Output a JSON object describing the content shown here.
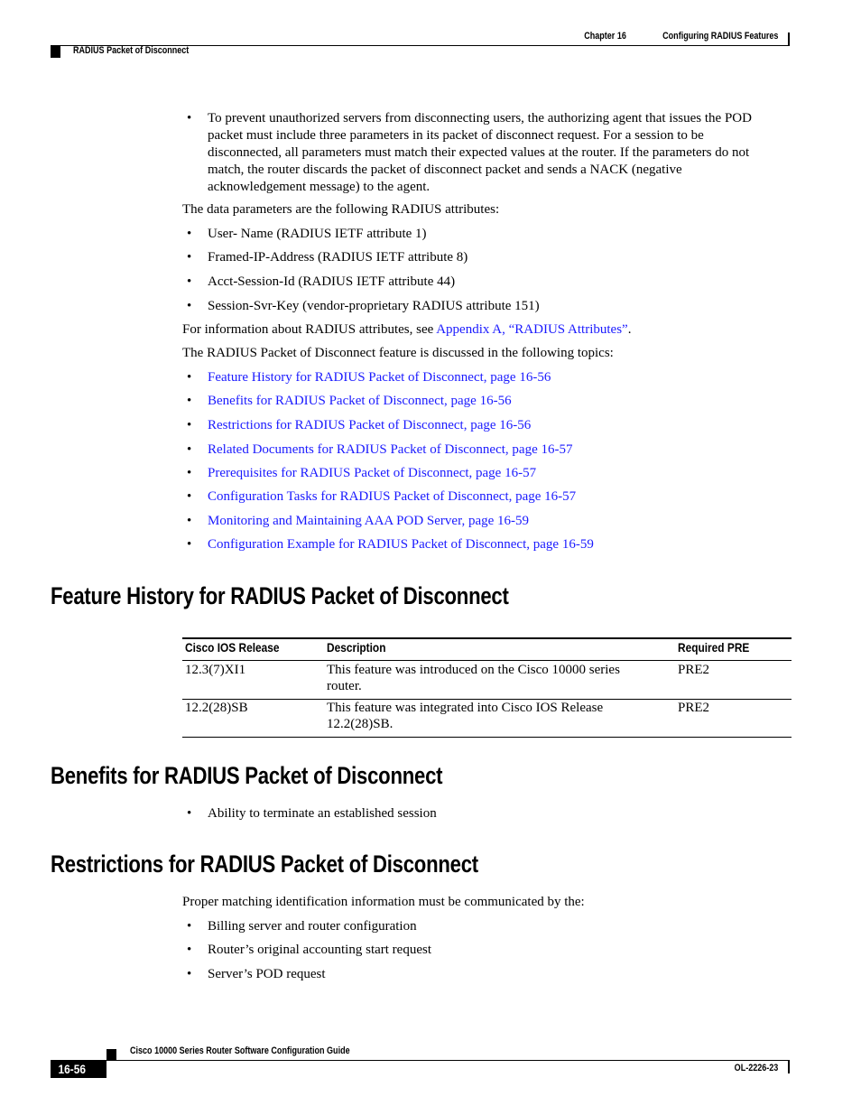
{
  "header": {
    "chapter": "Chapter 16",
    "chapter_title": "Configuring RADIUS Features",
    "section": "RADIUS Packet of Disconnect"
  },
  "intro": {
    "bullet_pod": "To prevent unauthorized servers from disconnecting users, the authorizing agent that issues the POD packet must include three parameters in its packet of disconnect request. For a session to be disconnected, all parameters must match their expected values at the router. If the parameters do not match, the router discards the packet of disconnect packet and sends a NACK (negative acknowledgement message) to the agent.",
    "bullet_pod_lines": [
      "To prevent unauthorized servers from disconnecting users, the authorizing agent that issues the POD",
      "packet must include three parameters in its packet of disconnect request. For a session to be",
      "disconnected, all parameters must match their expected values at the router. If the parameters do not",
      "match, the router discards the packet of disconnect packet and sends a NACK (negative",
      "acknowledgement message) to the agent."
    ],
    "data_params_text": "The data parameters are the following RADIUS attributes:",
    "attributes": [
      "User- Name (RADIUS IETF attribute 1)",
      "Framed-IP-Address (RADIUS IETF attribute 8)",
      "Acct-Session-Id (RADIUS IETF attribute 44)",
      "Session-Svr-Key (vendor-proprietary RADIUS attribute 151)"
    ],
    "info_prefix": "For information about RADIUS attributes, see ",
    "info_link": "Appendix A, “RADIUS Attributes”",
    "info_suffix": ".",
    "topics_intro": "The RADIUS Packet of Disconnect feature is discussed in the following topics:",
    "topics": [
      "Feature History for RADIUS Packet of Disconnect, page 16-56",
      "Benefits for RADIUS Packet of Disconnect, page 16-56",
      "Restrictions for RADIUS Packet of Disconnect, page 16-56",
      "Related Documents for RADIUS Packet of Disconnect, page 16-57",
      "Prerequisites for RADIUS Packet of Disconnect, page 16-57",
      "Configuration Tasks for RADIUS Packet of Disconnect, page 16-57",
      "Monitoring and Maintaining AAA POD Server, page 16-59",
      "Configuration Example for RADIUS Packet of Disconnect, page 16-59"
    ]
  },
  "feature_history": {
    "heading": "Feature History for RADIUS Packet of Disconnect",
    "columns": [
      "Cisco IOS Release",
      "Description",
      "Required PRE"
    ],
    "rows": [
      {
        "release": "12.3(7)XI1",
        "description_lines": [
          "This feature was introduced on the Cisco 10000 series",
          "router."
        ],
        "pre": "PRE2"
      },
      {
        "release": "12.2(28)SB",
        "description_lines": [
          "This feature was integrated into Cisco IOS Release",
          "12.2(28)SB."
        ],
        "pre": "PRE2"
      }
    ]
  },
  "benefits": {
    "heading": "Benefits for RADIUS Packet of Disconnect",
    "items": [
      "Ability to terminate an established session"
    ]
  },
  "restrictions": {
    "heading": "Restrictions for RADIUS Packet of Disconnect",
    "intro": "Proper matching identification information must be communicated by the:",
    "items": [
      "Billing server and router configuration",
      "Router’s original accounting start request",
      "Server’s POD request"
    ]
  },
  "footer": {
    "guide_title": "Cisco 10000 Series Router Software Configuration Guide",
    "page_number": "16-56",
    "doc_id": "OL-2226-23"
  },
  "colors": {
    "link": "#1a1aff",
    "text": "#000000"
  }
}
